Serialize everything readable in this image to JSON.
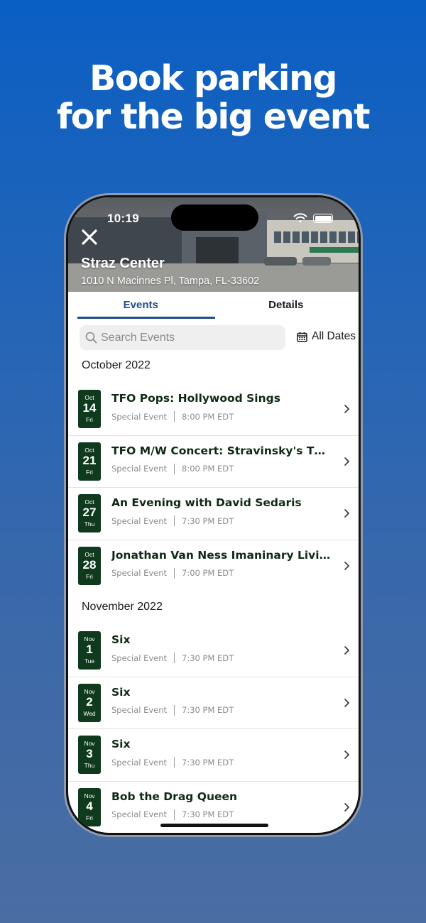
{
  "headline": {
    "line1": "Book parking",
    "line2": "for the big event"
  },
  "status_bar": {
    "time": "10:19"
  },
  "venue": {
    "name": "Straz Center",
    "address": "1010 N Macinnes Pl, Tampa, FL-33602"
  },
  "tabs": [
    {
      "label": "Events",
      "active": true
    },
    {
      "label": "Details",
      "active": false
    }
  ],
  "search": {
    "placeholder": "Search Events",
    "value": ""
  },
  "date_filter": {
    "label": "All Dates"
  },
  "months": [
    {
      "label": "October 2022",
      "events": [
        {
          "month": "Oct",
          "day": "14",
          "weekday": "Fri",
          "title": "TFO Pops: Hollywood Sings",
          "type": "Special Event",
          "time": "8:00 PM EDT"
        },
        {
          "month": "Oct",
          "day": "21",
          "weekday": "Fri",
          "title": "TFO M/W Concert: Stravinsky's The Ri...",
          "type": "Special Event",
          "time": "8:00 PM EDT"
        },
        {
          "month": "Oct",
          "day": "27",
          "weekday": "Thu",
          "title": "An Evening with David Sedaris",
          "type": "Special Event",
          "time": "7:30 PM EDT"
        },
        {
          "month": "Oct",
          "day": "28",
          "weekday": "Fri",
          "title": "Jonathan Van Ness Imaninary Living...",
          "type": "Special Event",
          "time": "7:00 PM EDT"
        }
      ]
    },
    {
      "label": "November 2022",
      "events": [
        {
          "month": "Nov",
          "day": "1",
          "weekday": "Tue",
          "title": "Six",
          "type": "Special Event",
          "time": "7:30 PM EDT"
        },
        {
          "month": "Nov",
          "day": "2",
          "weekday": "Wed",
          "title": "Six",
          "type": "Special Event",
          "time": "7:30 PM EDT"
        },
        {
          "month": "Nov",
          "day": "3",
          "weekday": "Thu",
          "title": "Six",
          "type": "Special Event",
          "time": "7:30 PM EDT"
        },
        {
          "month": "Nov",
          "day": "4",
          "weekday": "Fri",
          "title": "Bob the Drag Queen",
          "type": "Special Event",
          "time": "7:30 PM EDT"
        }
      ]
    }
  ],
  "colors": {
    "accent": "#1f4d8a",
    "badge": "#0f3a1e",
    "background_top": "#0a5fc4",
    "background_bottom": "#4a6da3"
  }
}
